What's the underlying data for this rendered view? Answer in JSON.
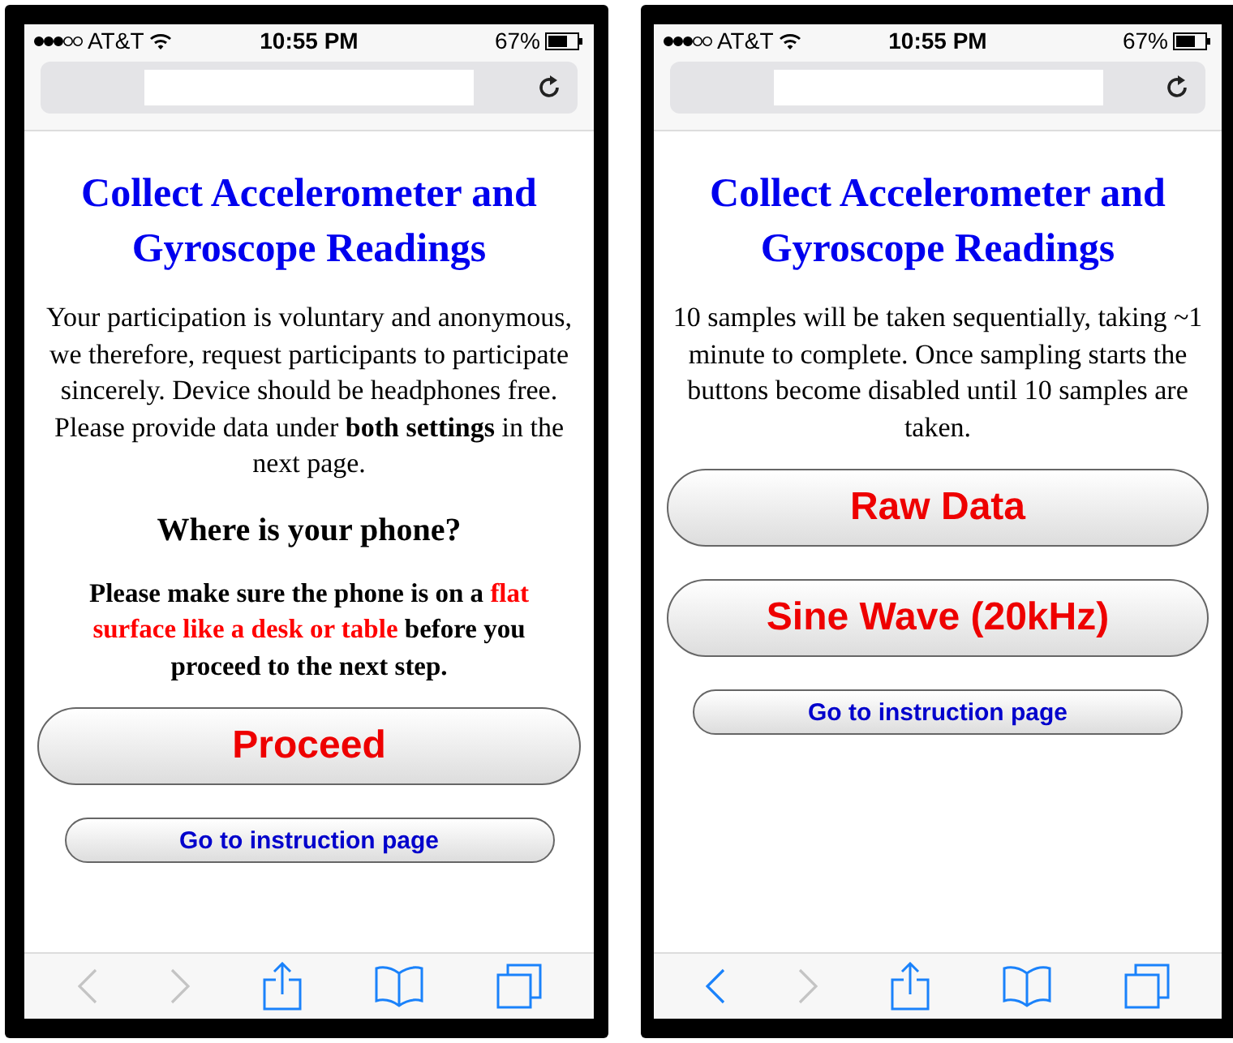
{
  "phones": [
    {
      "status_bar": {
        "carrier": "AT&T",
        "time": "10:55 PM",
        "battery": "67%"
      },
      "content": [
        {
          "kind": "heading",
          "text": "Collect Accelerometer and Gyroscope Readings"
        },
        {
          "kind": "paragraph",
          "text": "Your participation is voluntary and anonymous, we therefore, request participants to participate sincerely. Device should be headphones free. Please provide data under **both settings** in the next page."
        },
        {
          "kind": "subheading",
          "text": "Where is your phone?"
        },
        {
          "kind": "notice",
          "segments": [
            {
              "text": "Please make sure the phone is on a ",
              "highlight": false
            },
            {
              "text": "flat surface like a desk or table",
              "highlight": true
            },
            {
              "text": " before you proceed to the next step.",
              "highlight": false
            }
          ]
        },
        {
          "kind": "big-button",
          "text": "Proceed"
        },
        {
          "kind": "small-button",
          "text": "Go to instruction page"
        }
      ],
      "toolbar": {
        "back_disabled": true,
        "forward_disabled": true
      }
    },
    {
      "status_bar": {
        "carrier": "AT&T",
        "time": "10:55 PM",
        "battery": "67%"
      },
      "content": [
        {
          "kind": "heading",
          "text": "Collect Accelerometer and Gyroscope Readings"
        },
        {
          "kind": "paragraph",
          "text": "10 samples will be taken sequentially, taking ~1 minute to complete. Once sampling starts the buttons become disabled until 10 samples are taken."
        },
        {
          "kind": "big-button",
          "text": "Raw Data"
        },
        {
          "kind": "big-button",
          "text": "Sine Wave (20kHz)"
        },
        {
          "kind": "small-button",
          "text": "Go to instruction page"
        }
      ],
      "toolbar": {
        "back_disabled": false,
        "forward_disabled": true
      }
    }
  ]
}
